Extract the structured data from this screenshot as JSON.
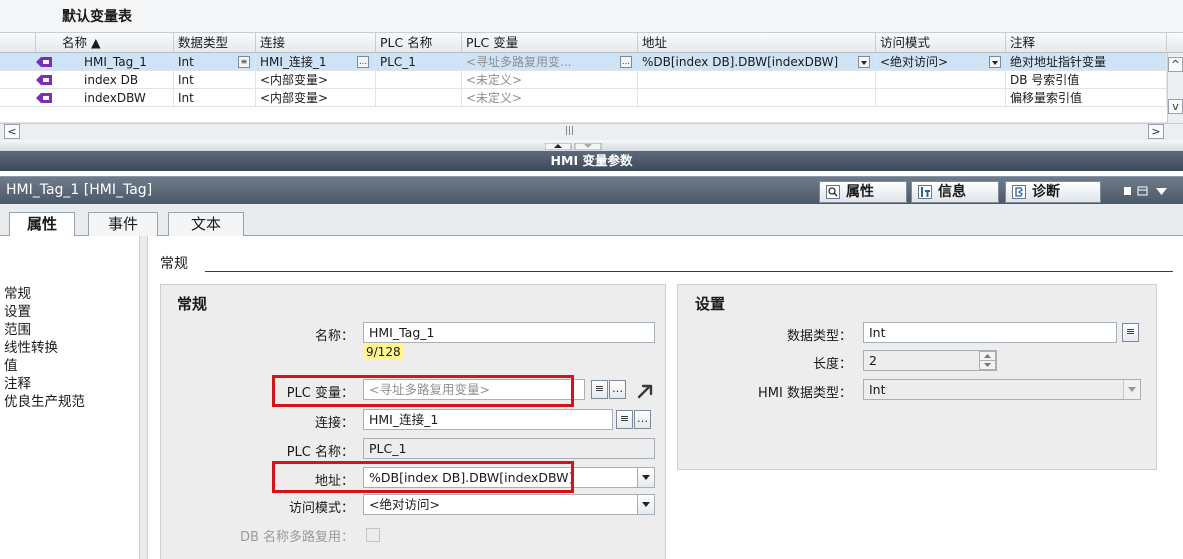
{
  "table": {
    "title": "默认变量表",
    "columns": [
      "名称 ▲",
      "数据类型",
      "连接",
      "PLC 名称",
      "PLC 变量",
      "地址",
      "访问模式",
      "注释"
    ],
    "rows": [
      {
        "name": "HMI_Tag_1",
        "type": "Int",
        "conn": "HMI_连接_1",
        "plc": "PLC_1",
        "plcvar": "<寻址多路复用变...",
        "addr": "%DB[index DB].DBW[indexDBW]",
        "access": "<绝对访问>",
        "comment": "绝对地址指针变量"
      },
      {
        "name": "index DB",
        "type": "Int",
        "conn": "<内部变量>",
        "plc": "",
        "plcvar": "<未定义>",
        "addr": "",
        "access": "",
        "comment": "DB 号索引值"
      },
      {
        "name": "indexDBW",
        "type": "Int",
        "conn": "<内部变量>",
        "plc": "",
        "plcvar": "<未定义>",
        "addr": "",
        "access": "",
        "comment": "偏移量索引值"
      }
    ]
  },
  "hmi_bar": "HMI 变量参数",
  "panel": {
    "title": "HMI_Tag_1 [HMI_Tag]",
    "right_tabs": {
      "props": "属性",
      "info": "信息",
      "diag": "诊断"
    }
  },
  "tabs": [
    "属性",
    "事件",
    "文本"
  ],
  "nav": [
    "常规",
    "设置",
    "范围",
    "线性转换",
    "值",
    "注释",
    "优良生产规范"
  ],
  "section": "常规",
  "general": {
    "title": "常规",
    "name_label": "名称：",
    "name_value": "HMI_Tag_1",
    "name_counter": "9/128",
    "plcvar_label": "PLC 变量：",
    "plcvar_value": "<寻址多路复用变量>",
    "conn_label": "连接：",
    "conn_value": "HMI_连接_1",
    "plcname_label": "PLC 名称：",
    "plcname_value": "PLC_1",
    "addr_label": "地址：",
    "addr_value": "%DB[index DB].DBW[indexDBW]",
    "access_label": "访问模式：",
    "access_value": "<绝对访问>",
    "dbmux_label": "DB 名称多路复用："
  },
  "settings": {
    "title": "设置",
    "dtype_label": "数据类型：",
    "dtype_value": "Int",
    "len_label": "长度：",
    "len_value": "2",
    "hmitype_label": "HMI 数据类型：",
    "hmitype_value": "Int"
  },
  "colors": {
    "highlight": "#d4141a",
    "selection": "#cfe3f7",
    "counter": "#fff68f"
  }
}
